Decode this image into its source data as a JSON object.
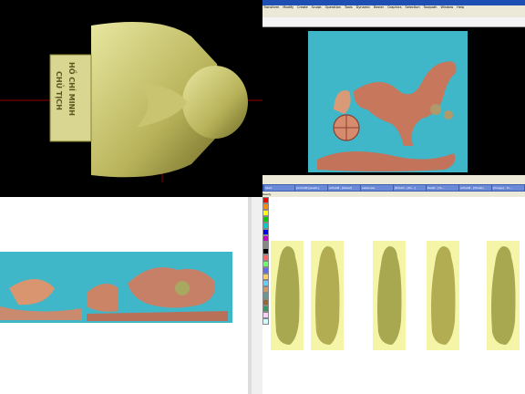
{
  "quadrant1": {
    "bust_inscription_line1": "CHỦ TỊCH",
    "bust_inscription_line2": "HỒ CHÍ MINH"
  },
  "quadrant2": {
    "menu_items": [
      "Transform",
      "Modify",
      "Create",
      "Sculpt",
      "Operation",
      "Tools",
      "Dynamic",
      "Bezier",
      "Graphics",
      "Selection",
      "Toolpath",
      "Window",
      "Help"
    ],
    "colors": {
      "titlebar": "#1d4fb4",
      "relief_bg": "#3fb7c9"
    }
  },
  "quadrant4": {
    "tabs": [
      "Start",
      "[ArtCAM] Jewelry",
      "ArtCAM - [Relief]",
      "Lebanese",
      "JDPaint - [Ho...]",
      "Relief - [Tu...",
      "ArtCAM - [Model]",
      "[Image] - Tu..."
    ],
    "statusbar_text": "Ready",
    "colors": {
      "figure_bg": "#f5f5a8",
      "figure": "#a8a850"
    }
  }
}
